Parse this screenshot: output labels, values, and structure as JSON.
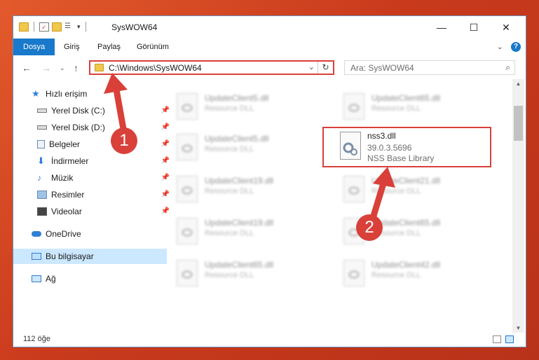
{
  "window": {
    "title": "SysWOW64",
    "controls": {
      "minimize": "—",
      "maximize": "☐",
      "close": "✕"
    }
  },
  "ribbon": {
    "tabs": [
      "Dosya",
      "Giriş",
      "Paylaş",
      "Görünüm"
    ],
    "help": "?"
  },
  "address": {
    "path": "C:\\Windows\\SysWOW64",
    "dropdown": "⌄",
    "refresh": "↻"
  },
  "search": {
    "placeholder": "Ara: SysWOW64",
    "icon": "⌕"
  },
  "nav": {
    "items": [
      {
        "label": "Hızlı erişim",
        "icon": "star-icon"
      },
      {
        "label": "Yerel Disk (C:)",
        "icon": "drive-icon",
        "pinned": true
      },
      {
        "label": "Yerel Disk (D:)",
        "icon": "drive-icon",
        "pinned": true
      },
      {
        "label": "Belgeler",
        "icon": "documents-icon",
        "pinned": true
      },
      {
        "label": "İndirmeler",
        "icon": "download-icon",
        "pinned": true
      },
      {
        "label": "Müzik",
        "icon": "music-icon",
        "pinned": true
      },
      {
        "label": "Resimler",
        "icon": "pictures-icon",
        "pinned": true
      },
      {
        "label": "Videolar",
        "icon": "videos-icon",
        "pinned": true
      },
      {
        "label": "OneDrive",
        "icon": "cloud-icon"
      },
      {
        "label": "Bu bilgisayar",
        "icon": "computer-icon",
        "selected": true
      },
      {
        "label": "Ağ",
        "icon": "network-icon"
      }
    ]
  },
  "files": [
    {
      "name": "UpdateClient5.dll",
      "type": "Resource DLL"
    },
    {
      "name": "UpdateClient65.dll",
      "type": "Resource DLL"
    },
    {
      "name": "UpdateClient5.dll",
      "type": "Resource DLL"
    },
    {
      "name": "UpdateClient19.dll",
      "type": "Resource DLL"
    },
    {
      "name": "UpdateClient21.dll",
      "type": "Resource DLL"
    },
    {
      "name": "UpdateClient19.dll",
      "type": "Resource DLL"
    },
    {
      "name": "UpdateClient65.dll",
      "type": "Resource DLL"
    },
    {
      "name": "UpdateClient65.dll",
      "type": "Resource DLL"
    },
    {
      "name": "UpdateClient42.dll",
      "type": "Resource DLL"
    }
  ],
  "highlighted_file": {
    "name": "nss3.dll",
    "version": "39.0.3.5696",
    "description": "NSS Base Library"
  },
  "status": {
    "count": "112 öğe"
  },
  "annotations": {
    "step1": "1",
    "step2": "2"
  },
  "colors": {
    "accent": "#1979ca",
    "highlight": "#d9403a",
    "selected_bg": "#cce8ff"
  }
}
